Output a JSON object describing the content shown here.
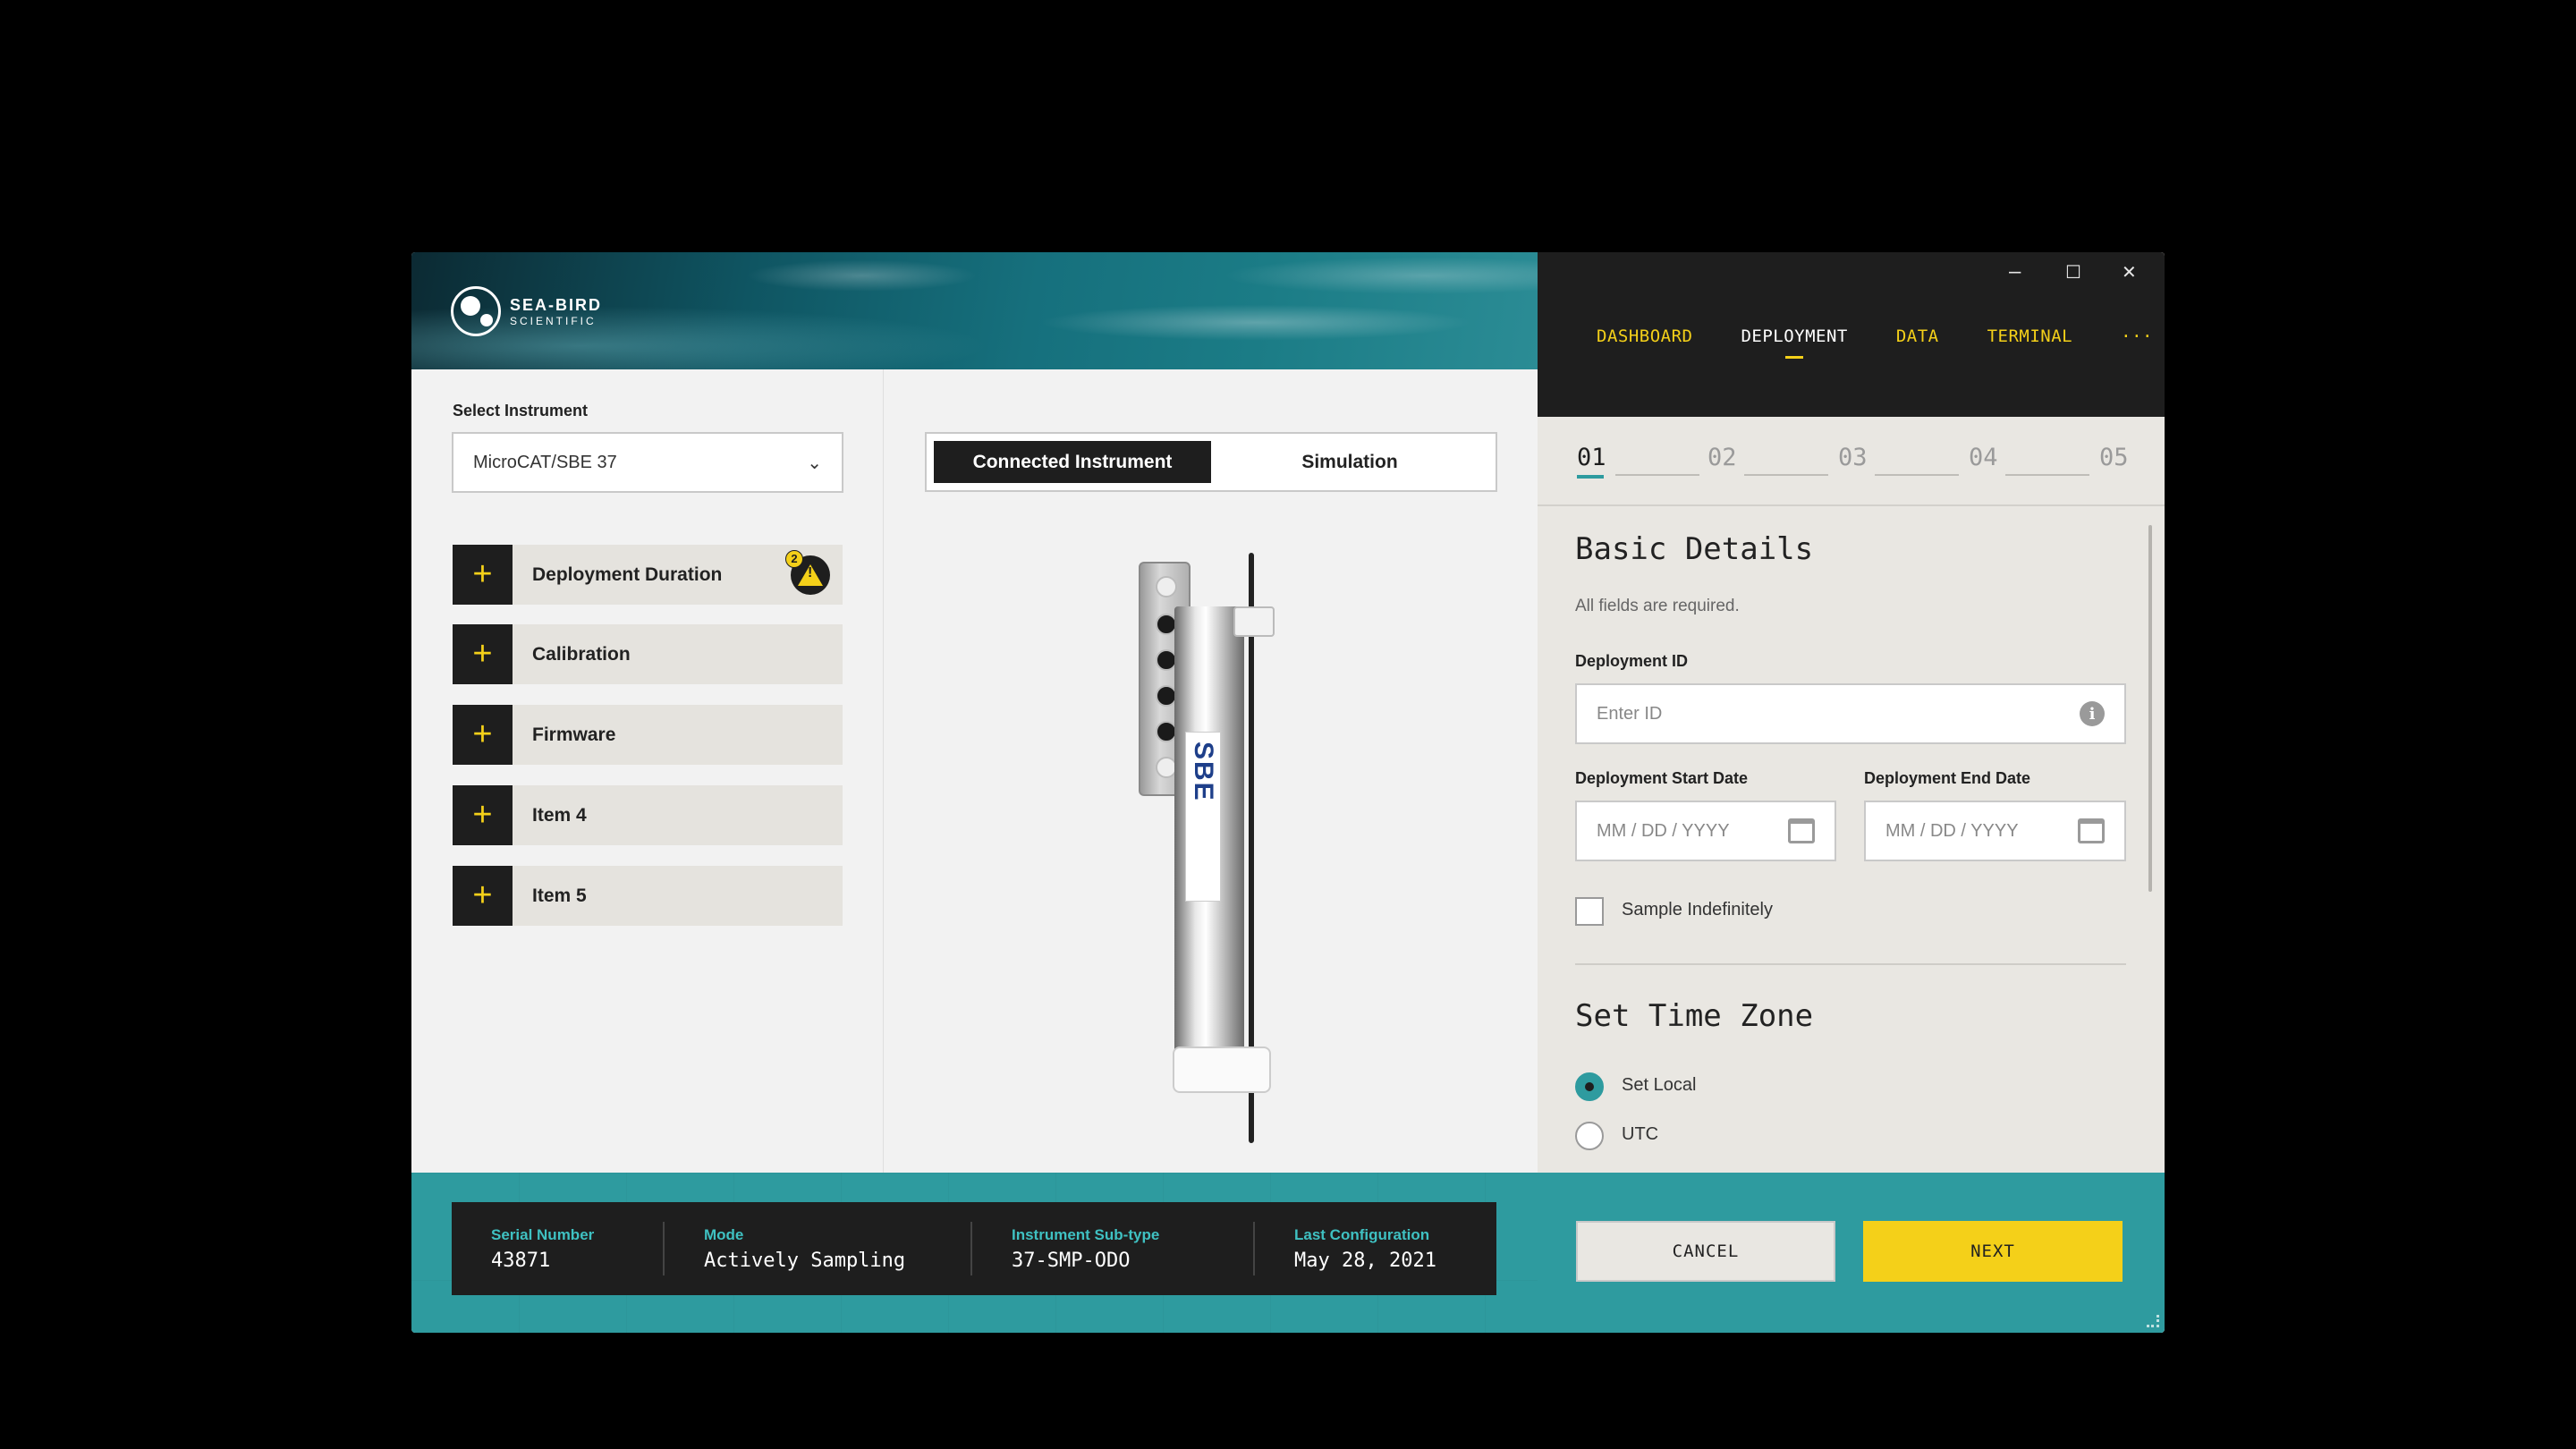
{
  "brand": {
    "line1": "SEA-BIRD",
    "line2": "SCIENTIFIC"
  },
  "window": {
    "minimize": "–",
    "maximize": "☐",
    "close": "✕"
  },
  "nav": {
    "items": [
      {
        "label": "DASHBOARD"
      },
      {
        "label": "DEPLOYMENT"
      },
      {
        "label": "DATA"
      },
      {
        "label": "TERMINAL"
      },
      {
        "label": "···"
      }
    ],
    "active": "DEPLOYMENT"
  },
  "instrument": {
    "select_label": "Select Instrument",
    "selected": "MicroCAT/SBE 37",
    "chevron": "⌄"
  },
  "accordion": {
    "plus": "+",
    "items": [
      {
        "label": "Deployment Duration",
        "warning_count": "2"
      },
      {
        "label": "Calibration"
      },
      {
        "label": "Firmware"
      },
      {
        "label": "Item 4"
      },
      {
        "label": "Item 5"
      }
    ],
    "warning_icon": "!"
  },
  "mode_toggle": {
    "options": [
      "Connected Instrument",
      "Simulation"
    ],
    "active": "Connected Instrument"
  },
  "device_label": "SBE",
  "info_bar": {
    "serial": {
      "key": "Serial Number",
      "value": "43871"
    },
    "mode": {
      "key": "Mode",
      "value": "Actively Sampling"
    },
    "subtype": {
      "key": "Instrument Sub-type",
      "value": "37-SMP-ODO"
    },
    "last_config": {
      "key": "Last Configuration",
      "value": "May 28, 2021"
    }
  },
  "steps": [
    "01",
    "02",
    "03",
    "04",
    "05"
  ],
  "active_step": "01",
  "form": {
    "title": "Basic Details",
    "note": "All fields are required.",
    "deployment_id": {
      "label": "Deployment ID",
      "placeholder": "Enter ID",
      "info_icon": "i"
    },
    "start_date": {
      "label": "Deployment Start Date",
      "placeholder": "MM / DD / YYYY"
    },
    "end_date": {
      "label": "Deployment End Date",
      "placeholder": "MM / DD / YYYY"
    },
    "sample_indefinitely": {
      "label": "Sample Indefinitely",
      "checked": false
    },
    "tz_title": "Set Time Zone",
    "tz_options": [
      {
        "label": "Set Local",
        "selected": true
      },
      {
        "label": "UTC",
        "selected": false
      }
    ]
  },
  "buttons": {
    "cancel": "CANCEL",
    "next": "NEXT"
  },
  "colors": {
    "accent_yellow": "#f4d019",
    "teal": "#2e9b9f",
    "dark": "#1e1e1e",
    "info_key": "#3fc1c2"
  }
}
